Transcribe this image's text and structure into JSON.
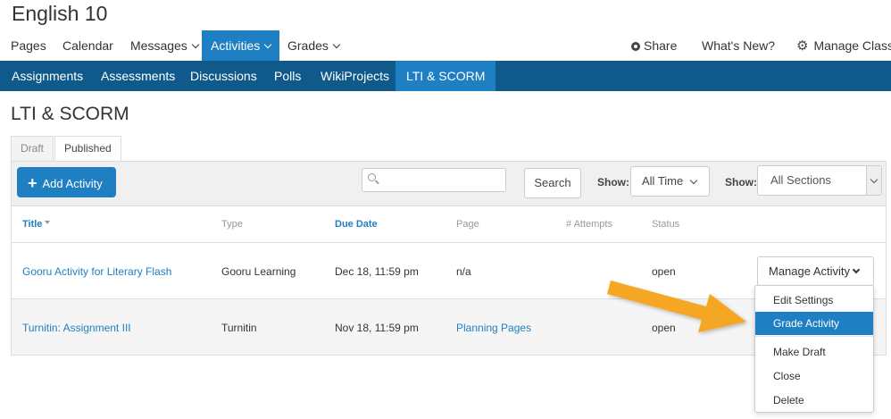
{
  "class_title": "English 10",
  "topnav": {
    "pages": "Pages",
    "calendar": "Calendar",
    "messages": "Messages",
    "activities": "Activities",
    "grades": "Grades",
    "share": "Share",
    "whats_new": "What's New?",
    "manage_class": "Manage Class"
  },
  "subnav": [
    "Assignments",
    "Assessments",
    "Discussions",
    "Polls",
    "WikiProjects",
    "LTI & SCORM"
  ],
  "page_title": "LTI & SCORM",
  "tabs": {
    "draft": "Draft",
    "published": "Published"
  },
  "toolbar": {
    "add_activity": "Add Activity",
    "search_placeholder": "",
    "search_button": "Search",
    "show_label": "Show:",
    "time_filter": "All Time",
    "sections_filter": "All Sections"
  },
  "table": {
    "headers": {
      "title": "Title",
      "type": "Type",
      "due_date": "Due Date",
      "page": "Page",
      "attempts": "# Attempts",
      "status": "Status"
    },
    "rows": [
      {
        "title": "Gooru Activity for Literary Flash",
        "type": "Gooru Learning",
        "due": "Dec 18, 11:59 pm",
        "page": "n/a",
        "status": "open"
      },
      {
        "title": "Turnitin: Assignment III",
        "type": "Turnitin",
        "due": "Nov 18, 11:59 pm",
        "page": "Planning Pages",
        "status": "open"
      }
    ]
  },
  "manage_button": "Manage Activity",
  "menu": [
    "Edit Settings",
    "Grade Activity",
    "Make Draft",
    "Close",
    "Delete"
  ],
  "colors": {
    "accent": "#1e7fc2",
    "subnav": "#0f5a8a",
    "arrow": "#f5a623"
  }
}
